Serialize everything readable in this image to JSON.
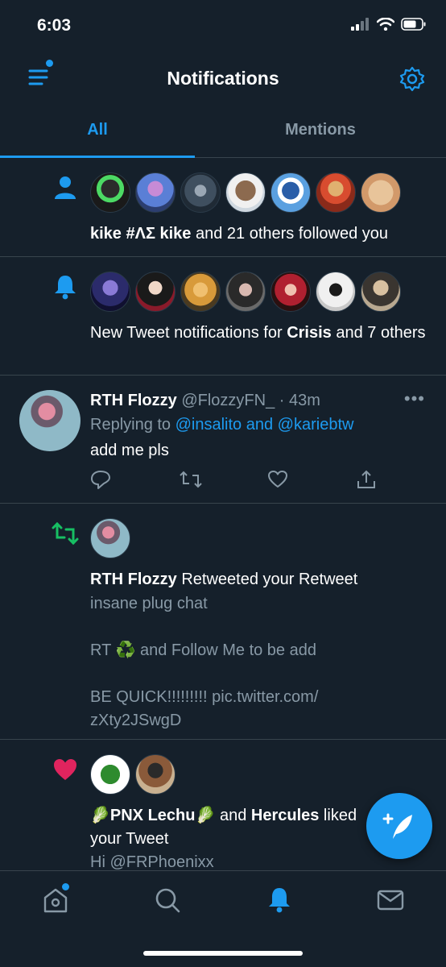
{
  "status": {
    "time": "6:03"
  },
  "header": {
    "title": "Notifications"
  },
  "tabs": [
    {
      "label": "All"
    },
    {
      "label": "Mentions"
    }
  ],
  "notifications": {
    "follows": {
      "name": "kike #ΛΣ kike",
      "rest": " and 21 others followed you"
    },
    "new_tweets": {
      "prefix": "New Tweet notifications for ",
      "name": "Crisis",
      "suffix": " and 7 others"
    },
    "reply": {
      "name": "RTH Flozzy",
      "handle": "@FlozzyFN_",
      "sep": " · ",
      "time": "43m",
      "replying_prefix": "Replying to ",
      "replying_to": "@insalito and @kariebtw",
      "text": "add me pls",
      "more": "•••"
    },
    "retweet": {
      "name": "RTH Flozzy",
      "action": " Retweeted your Retweet",
      "line1": "insane plug chat",
      "line2": "RT ♻️ and Follow Me to be add",
      "line3": "BE QUICK!!!!!!!!! pic.twitter.com/",
      "line4": "zXty2JSwgD"
    },
    "likes": {
      "name1": "🥬PNX Lechu🥬",
      "and": " and ",
      "name2": "Hercules",
      "rest": " liked",
      "line2": "your Tweet",
      "line3": "Hi @FRPhoenixx"
    }
  },
  "colors": {
    "background": "#15202b",
    "accent": "#1d9bf0",
    "muted": "#8899a6",
    "retweet": "#17bf63",
    "like": "#e0245e",
    "divider": "#38444d"
  },
  "icons": [
    "menu-icon",
    "gear-icon",
    "person-icon",
    "bell-icon",
    "retweet-icon",
    "heart-icon",
    "reply-icon",
    "share-icon",
    "compose-icon",
    "home-icon",
    "search-icon",
    "mail-icon"
  ]
}
